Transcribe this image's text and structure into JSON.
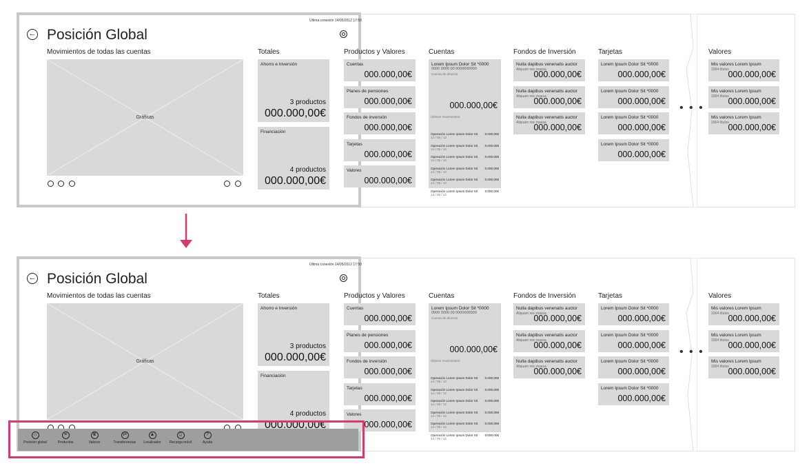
{
  "screen": {
    "last_connection": "Última conexión 14/05/2012 17:50",
    "title": "Posición Global",
    "back_icon": "back-arrow-icon",
    "search_icon": "search-icon"
  },
  "movimientos": {
    "heading": "Movimientos de todas las cuentas",
    "chart_label": "Gráficas",
    "icons": [
      "chart-line-icon",
      "percent-icon",
      "pie-icon",
      "euro-icon",
      "exchange-icon"
    ]
  },
  "totales": {
    "heading": "Totales",
    "tiles": [
      {
        "label": "Ahorro e Inversión",
        "products": "3 productos",
        "value": "000.000,00€"
      },
      {
        "label": "Financiación",
        "products": "4 productos",
        "value": "000.000,00€"
      }
    ]
  },
  "productos": {
    "heading": "Productos y Valores",
    "tiles": [
      {
        "label": "Cuentas",
        "value": "000.000,00€"
      },
      {
        "label": "Planes de pensiones",
        "value": "000.000,00€"
      },
      {
        "label": "Fondos de inversión",
        "value": "000.000,00€"
      },
      {
        "label": "Tarjetas",
        "value": "000.000,00€"
      },
      {
        "label": "Valores",
        "value": "000.000,00€"
      }
    ]
  },
  "cuentas": {
    "heading": "Cuentas",
    "account_name": "Lorem Ipsum Dolor Sit *0000",
    "account_number": "0000 0000 00 0000000000",
    "account_type": "Cuenta de ahorros",
    "balance": "000.000,00€",
    "ultimos_label": "Últimos movimientos",
    "operations": [
      {
        "name": "Operación Lorem Ipsum Dolor Sit",
        "date": "14 / 05 / 12",
        "amount": "0.000,00€"
      },
      {
        "name": "Operación Lorem Ipsum Dolor Sit",
        "date": "14 / 05 / 12",
        "amount": "0.000,00€"
      },
      {
        "name": "Operación Lorem Ipsum Dolor Sit",
        "date": "14 / 05 / 12",
        "amount": "0.000,00€"
      },
      {
        "name": "Operación Lorem Ipsum Dolor Sit",
        "date": "14 / 05 / 12",
        "amount": "0.000,00€"
      },
      {
        "name": "Operación Lorem Ipsum Dolor Sit",
        "date": "14 / 05 / 12",
        "amount": "0.000,00€"
      },
      {
        "name": "Operación Lorem Ipsum Dolor Sit",
        "date": "14 / 05 / 12",
        "amount": "0.000,00€"
      }
    ]
  },
  "fondos": {
    "heading": "Fondos de Inversión",
    "tiles": [
      {
        "label": "Nulla dapibus venenatis auctor",
        "sub": "Aliquam nec massa",
        "value": "000.000,00€"
      },
      {
        "label": "Nulla dapibus venenatis auctor",
        "sub": "Aliquam nec massa",
        "value": "000.000,00€"
      },
      {
        "label": "Nulla dapibus venenatis auctor",
        "sub": "Aliquam nec massa",
        "value": "000.000,00€"
      }
    ]
  },
  "tarjetas": {
    "heading": "Tarjetas",
    "tiles": [
      {
        "label": "Lorem Ipsum Dolor Sit *0000",
        "value": "000.000,00€"
      },
      {
        "label": "Lorem Ipsum Dolor Sit *0000",
        "value": "000.000,00€"
      },
      {
        "label": "Lorem Ipsum Dolor Sit *0000",
        "value": "000.000,00€"
      },
      {
        "label": "Lorem Ipsum Dolor Sit *0000",
        "value": "000.000,00€"
      }
    ]
  },
  "ellipsis": "• • •",
  "valores": {
    "heading": "Valores",
    "tiles": [
      {
        "label": "Mis valores Lorem Ipsum",
        "sub": "3364 títulos",
        "value": "000.000,00€"
      },
      {
        "label": "Mis valores Lorem Ipsum",
        "sub": "3364 títulos",
        "value": "000.000,00€"
      },
      {
        "label": "Mis valores Lorem Ipsum",
        "sub": "3364 títulos",
        "value": "000.000,00€"
      }
    ]
  },
  "appbar": {
    "buttons": [
      {
        "label": "Posición global",
        "icon": "home-icon",
        "glyph": "⌂"
      },
      {
        "label": "Productos",
        "icon": "list-icon",
        "glyph": "≡"
      },
      {
        "label": "Valores",
        "icon": "crown-icon",
        "glyph": "♛"
      },
      {
        "label": "Transferencias",
        "icon": "transfer-icon",
        "glyph": "⇄"
      },
      {
        "label": "Localizador",
        "icon": "map-icon",
        "glyph": "▲"
      },
      {
        "label": "Recarga móvil",
        "icon": "mobile-icon",
        "glyph": "▯"
      },
      {
        "label": "Ayuda",
        "icon": "help-icon",
        "glyph": "?"
      }
    ]
  },
  "colors": {
    "tile": "#d9d9d9",
    "accent": "#d63a6f",
    "appbar": "#9e9e9e"
  }
}
